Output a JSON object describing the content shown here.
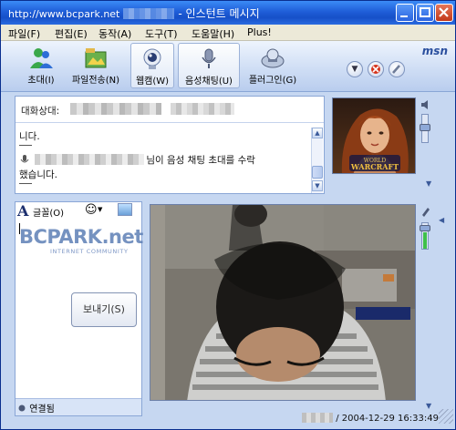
{
  "window": {
    "title": "인스턴트 메시지",
    "watermark": "http://www.bcpark.net",
    "controls": [
      "minimize",
      "maximize",
      "close"
    ]
  },
  "menu": [
    {
      "label": "파일(F)"
    },
    {
      "label": "편집(E)"
    },
    {
      "label": "동작(A)"
    },
    {
      "label": "도구(T)"
    },
    {
      "label": "도움말(H)"
    },
    {
      "label": "Plus!"
    }
  ],
  "toolbar": {
    "tools": [
      {
        "label": "초대(I)",
        "icon": "invite-icon"
      },
      {
        "label": "파일전송(N)",
        "icon": "file-transfer-icon"
      },
      {
        "label": "웹캠(W)",
        "icon": "webcam-icon"
      },
      {
        "label": "음성채팅(U)",
        "icon": "voice-chat-icon"
      },
      {
        "label": "플러그인(G)",
        "icon": "plugin-icon"
      }
    ],
    "brand": "msn"
  },
  "conversation": {
    "to_label": "대화상대:",
    "line1": "니다.",
    "line2_suffix": "님이 음성 채팅 초대를 수락",
    "line3": "했습니다."
  },
  "compose": {
    "font_label": "글꼴(O)",
    "logo_main": "BCPARK.net",
    "logo_sub": "INTERNET COMMUNITY",
    "send_label": "보내기(S)"
  },
  "status": {
    "text": "연결됨"
  },
  "webcam": {
    "timestamp": "/ 2004-12-29 16:33:49"
  },
  "colors": {
    "titlebar": "#1f5ed8",
    "panel_border": "#8aa6d6",
    "background": "#c6d7f1"
  }
}
